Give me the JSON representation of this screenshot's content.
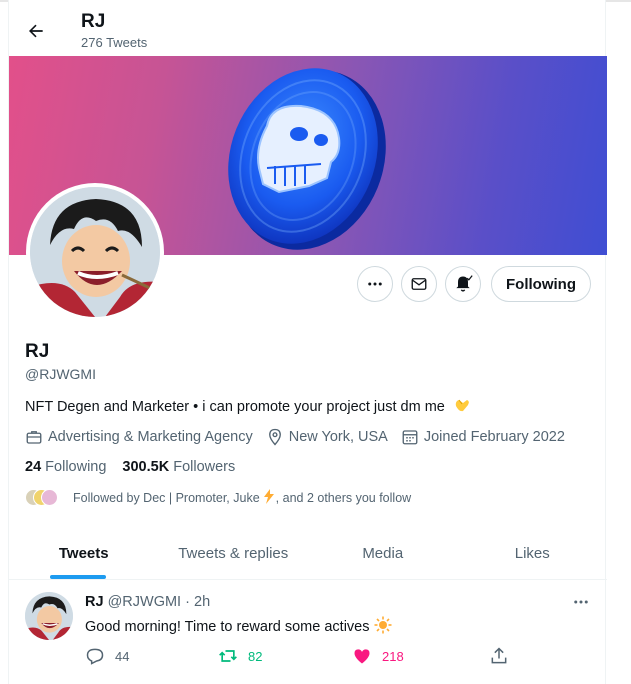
{
  "header": {
    "name": "RJ",
    "tweet_count": "276 Tweets"
  },
  "profile": {
    "name": "RJ",
    "handle": "@RJWGMI",
    "bio": "NFT Degen and Marketer • i can promote your project just dm me",
    "category": "Advertising & Marketing Agency",
    "location": "New York, USA",
    "joined": "Joined February 2022",
    "following_count": "24",
    "following_label": "Following",
    "followers_count": "300.5K",
    "followers_label": "Followers",
    "followed_by_prefix": "Followed by Dec | Promoter, Juke",
    "followed_by_suffix": ", and 2 others you follow"
  },
  "buttons": {
    "follow": "Following"
  },
  "tabs": [
    {
      "label": "Tweets",
      "active": true
    },
    {
      "label": "Tweets & replies",
      "active": false
    },
    {
      "label": "Media",
      "active": false
    },
    {
      "label": "Likes",
      "active": false
    }
  ],
  "tweet": {
    "name": "RJ",
    "handle": "@RJWGMI",
    "sep": "·",
    "time": "2h",
    "text": "Good morning! Time to reward some actives",
    "replies": "44",
    "retweets": "82",
    "likes": "218"
  },
  "icons": [
    "back-arrow-icon",
    "more-icon",
    "mail-icon",
    "bell-add-icon",
    "briefcase-icon",
    "location-pin-icon",
    "calendar-icon",
    "clap-emoji-icon",
    "lightning-emoji-icon",
    "sun-emoji-icon",
    "reply-icon",
    "retweet-icon",
    "heart-icon",
    "share-icon"
  ],
  "colors": {
    "accent": "#1d9bf0",
    "retweet": "#00ba7c",
    "like": "#f91880",
    "muted": "#536471",
    "text": "#0f1419"
  }
}
